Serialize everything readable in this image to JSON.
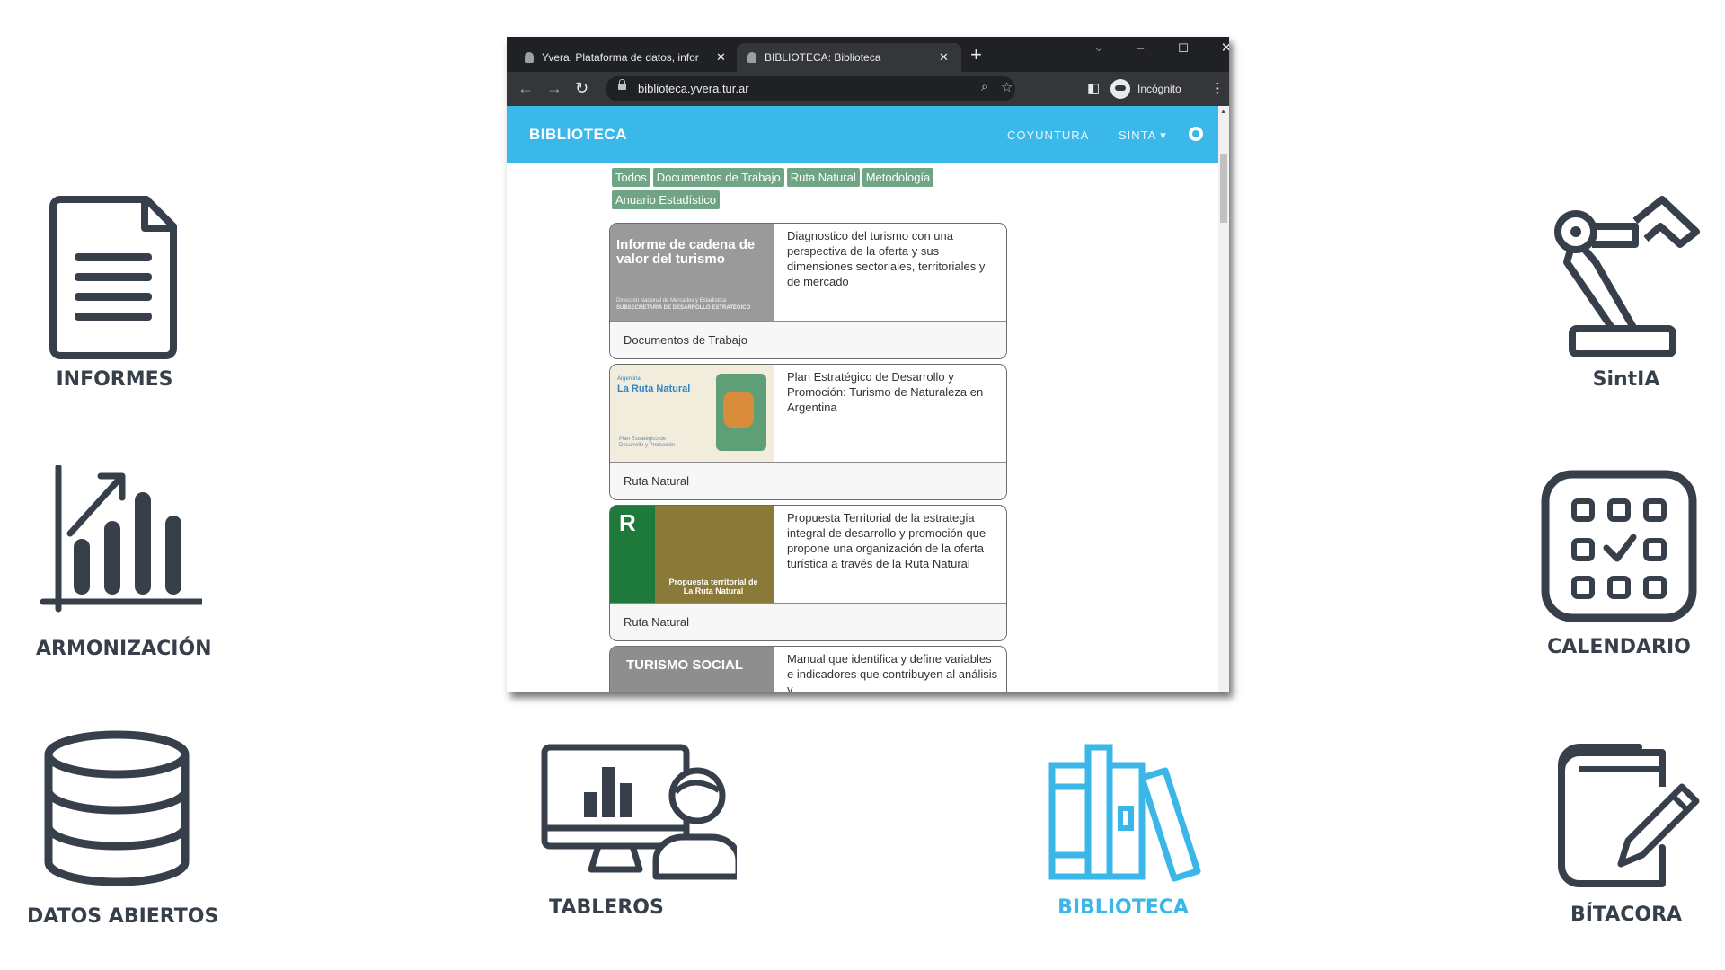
{
  "tiles": {
    "informes": {
      "label": "INFORMES",
      "icon": "document-icon"
    },
    "armonizacion": {
      "label": "ARMONIZACIÓN",
      "icon": "bar-chart-trend-icon"
    },
    "datos_abiertos": {
      "label": "DATOS ABIERTOS",
      "icon": "database-icon"
    },
    "tableros": {
      "label": "TABLEROS",
      "icon": "dashboard-monitor-user-icon"
    },
    "biblioteca": {
      "label": "BIBLIOTECA",
      "icon": "books-icon",
      "active": true
    },
    "sintia": {
      "label": "SintIA",
      "icon": "robot-arm-icon"
    },
    "calendario": {
      "label": "CALENDARIO",
      "icon": "calendar-check-icon"
    },
    "bitacora": {
      "label": "BÍTACORA",
      "icon": "notebook-pencil-icon"
    }
  },
  "colors": {
    "icon_dark": "#37404a",
    "accent": "#3bb6e8",
    "navbar": "#3bb8ea",
    "pill": "#6fa584",
    "browser_frame": "#202124",
    "toolbar": "#35363a"
  },
  "browser": {
    "tabs": [
      {
        "title": "Yvera, Plataforma de datos, infor",
        "active": false
      },
      {
        "title": "BIBLIOTECA: Biblioteca",
        "active": true
      }
    ],
    "url": "biblioteca.yvera.tur.ar",
    "incognito_label": "Incógnito"
  },
  "site": {
    "brand": "BIBLIOTECA",
    "nav": [
      "COYUNTURA",
      "SINTA ▾"
    ],
    "filters": [
      "Todos",
      "Documentos de Trabajo",
      "Ruta Natural",
      "Metodología",
      "Anuario Estadístico"
    ],
    "cards": [
      {
        "thumb_title": "Informe de cadena de valor del turismo",
        "thumb_small_1": "Dirección Nacional de Mercados y Estadística",
        "thumb_small_2": "SUBSECRETARÍA DE DESARROLLO ESTRATÉGICO",
        "description": "Diagnostico del turismo con una perspectiva de la oferta y sus dimensiones sectoriales, territoriales y de mercado",
        "category": "Documentos de Trabajo"
      },
      {
        "thumb_logo_1": "Argentina",
        "thumb_logo_2": "La Ruta Natural",
        "thumb_sub": "Plan Estratégico de Desarrollo y Promoción",
        "description": "Plan Estratégico de Desarrollo y Promoción: Turismo de Naturaleza en Argentina",
        "category": "Ruta Natural"
      },
      {
        "thumb_title": "Propuesta territorial de La Ruta Natural",
        "description": "Propuesta Territorial de la estrategia integral de desarrollo y promoción que propone una organización de la oferta turística a través de la Ruta Natural",
        "category": "Ruta Natural"
      },
      {
        "thumb_title": "TURISMO SOCIAL",
        "description": "Manual que identifica y define variables e indicadores que contribuyen al análisis y",
        "category": ""
      }
    ]
  }
}
